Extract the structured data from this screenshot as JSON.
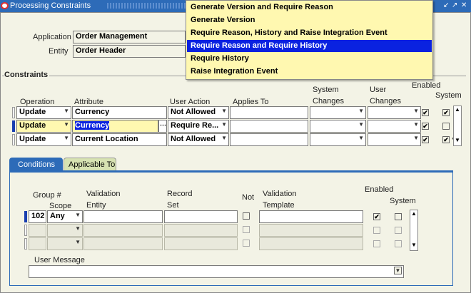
{
  "window": {
    "title": "Processing Constraints",
    "controls": [
      "↙",
      "↗",
      "✕"
    ]
  },
  "header": {
    "application_label": "Application",
    "application_value": "Order Management",
    "entity_label": "Entity",
    "entity_value": "Order Header"
  },
  "constraints": {
    "section_label": "Constraints",
    "columns": {
      "operation": "Operation",
      "attribute": "Attribute",
      "user_action": "User Action",
      "applies_to": "Applies To",
      "system_changes": "System\nChanges",
      "system_changes_l1": "System",
      "system_changes_l2": "Changes",
      "user_changes_l1": "User",
      "user_changes_l2": "Changes",
      "enabled": "Enabled",
      "system": "System"
    },
    "rows": [
      {
        "operation": "Update",
        "attribute": "Currency",
        "user_action": "Not Allowed",
        "applies_to": "",
        "enabled": true,
        "system": true
      },
      {
        "operation": "Update",
        "attribute": "Currency",
        "user_action": "Require Re...",
        "applies_to": "",
        "enabled": true,
        "system": false
      },
      {
        "operation": "Update",
        "attribute": "Current Location",
        "user_action": "Not Allowed",
        "applies_to": "",
        "enabled": true,
        "system": true
      }
    ]
  },
  "user_action_dropdown": {
    "options": [
      "Generate Version and Require Reason",
      "Generate Version",
      "Require Reason, History and Raise Integration Event",
      "Require Reason and Require History",
      "Require History",
      "Raise Integration Event"
    ],
    "selected_index": 3
  },
  "tabs": {
    "conditions": "Conditions",
    "applicable_to": "Applicable To"
  },
  "conditions": {
    "columns": {
      "group_l1": "Group #",
      "scope": "Scope",
      "validation_entity_l1": "Validation",
      "validation_entity_l2": "Entity",
      "record_set_l1": "Record",
      "record_set_l2": "Set",
      "not": "Not",
      "validation_template_l1": "Validation",
      "validation_template_l2": "Template",
      "enabled": "Enabled",
      "system": "System"
    },
    "rows": [
      {
        "group": "102",
        "scope": "Any",
        "entity": "",
        "record_set": "",
        "not": false,
        "template": "",
        "enabled": true,
        "system": false
      },
      {
        "group": "",
        "scope": "",
        "entity": "",
        "record_set": "",
        "not": false,
        "template": "",
        "enabled": false,
        "system": false
      },
      {
        "group": "",
        "scope": "",
        "entity": "",
        "record_set": "",
        "not": false,
        "template": "",
        "enabled": false,
        "system": false
      }
    ],
    "user_message_label": "User Message",
    "user_message_value": ""
  }
}
